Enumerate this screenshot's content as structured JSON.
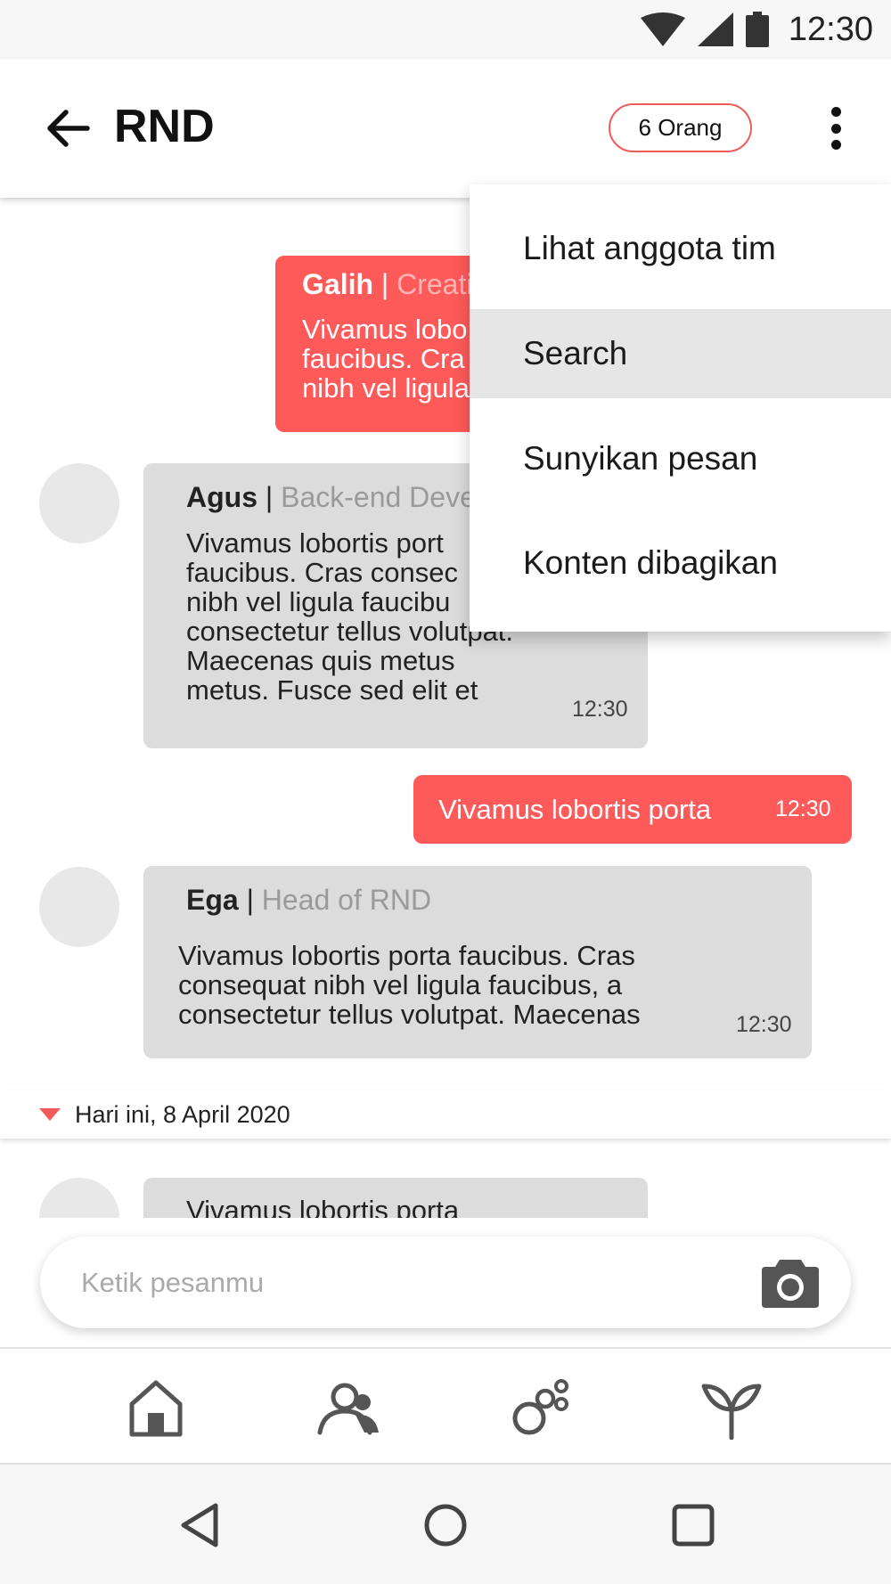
{
  "status_bar": {
    "time": "12:30",
    "icons": [
      "wifi-icon",
      "signal-icon",
      "battery-icon"
    ]
  },
  "header": {
    "title": "RND",
    "member_badge": "6 Orang"
  },
  "menu": {
    "items": [
      {
        "label": "Lihat anggota tim"
      },
      {
        "label": "Search"
      },
      {
        "label": "Sunyikan pesan"
      },
      {
        "label": "Konten dibagikan"
      }
    ]
  },
  "messages": [
    {
      "type": "sent",
      "sender": "Galih",
      "role": "Creati",
      "text": [
        "Vivamus lobo",
        "faucibus. Cra",
        "nibh vel ligula"
      ]
    },
    {
      "type": "received",
      "sender": "Agus",
      "role": "Back-end Deve",
      "text": [
        "Vivamus lobortis port",
        "faucibus. Cras consec",
        "nibh vel ligula faucibu",
        "consectetur tellus volutpat.",
        "Maecenas quis metus",
        "metus. Fusce sed elit et"
      ],
      "time": "12:30"
    },
    {
      "type": "sent",
      "text": [
        "Vivamus lobortis porta"
      ],
      "time": "12:30"
    },
    {
      "type": "received",
      "sender": "Ega",
      "role": "Head of RND",
      "text": [
        "Vivamus lobortis porta faucibus. Cras",
        "consequat nibh vel ligula faucibus, a",
        "consectetur tellus volutpat. Maecenas"
      ],
      "time": "12:30"
    },
    {
      "type": "received",
      "text": [
        "Vivamus lobortis porta"
      ]
    }
  ],
  "date_divider": {
    "label": "Hari ini, 8 April 2020"
  },
  "composer": {
    "placeholder": "Ketik pesanmu"
  },
  "bottom_nav": {
    "items": [
      "home-icon",
      "people-icon",
      "apps-icon",
      "sprout-icon"
    ]
  },
  "system_nav": {
    "items": [
      "back-triangle-icon",
      "home-circle-icon",
      "recents-square-icon"
    ]
  },
  "colors": {
    "accent": "#ff5a5a",
    "received_bubble": "#dcdcdc",
    "menu_active": "#e6e6e6"
  }
}
